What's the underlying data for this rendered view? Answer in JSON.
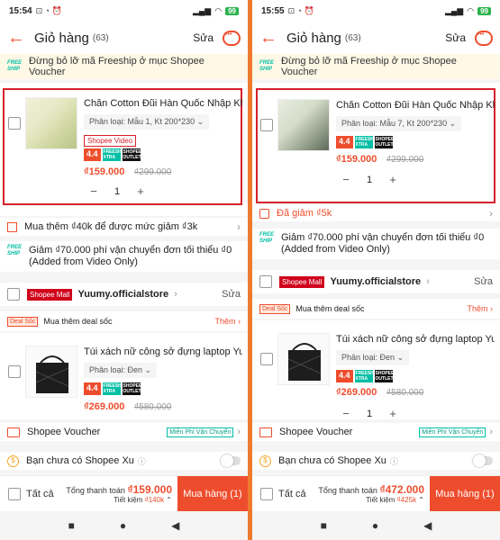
{
  "left": {
    "status": {
      "time": "15:54",
      "battery": "99"
    },
    "header": {
      "back": "←",
      "title": "Giỏ hàng",
      "count": "(63)",
      "edit": "Sửa"
    },
    "freeship_banner": {
      "tag": "FREE SHIP",
      "text": "Đừng bỏ lỡ mã Freeship ở mục Shopee Voucher"
    },
    "item1": {
      "name": "Chăn Cotton Đũi Hàn Quốc Nhập Khẩ...",
      "variant": "Phân loại: Mẫu 1, Kt 200*230",
      "video_badge": "Shopee Video",
      "badge_44": "4.4",
      "badge_free": "FREESHIP XTRA",
      "badge_outlet": "SHOPEE OUTLET",
      "price": "₫159.000",
      "old_price": "₫299.000",
      "qty": "1"
    },
    "promo_row": "Mua thêm ₫40k để được mức giảm ₫3k",
    "ship_discount": {
      "tag": "FREE SHIP",
      "line1": "Giảm ₫70.000 phí vận chuyển đơn tối thiểu ₫0",
      "line2": "(Added from Video Only)"
    },
    "shop": {
      "mall": "Shopee Mall",
      "name": "Yuumy.officialstore",
      "edit": "Sửa"
    },
    "deal": {
      "tag": "Deal Sốc",
      "text": "Mua thêm deal sốc",
      "more": "Thêm"
    },
    "item2": {
      "name": "Túi xách nữ công sở đựng laptop Yuu...",
      "variant": "Phân loại: Đen",
      "badge_44": "4.4",
      "badge_free": "FREESHIP XTRA",
      "badge_outlet": "SHOPEE OUTLET",
      "price": "₫269.000",
      "old_price": "₫580.000"
    },
    "voucher": {
      "label": "Shopee Voucher",
      "badge": "Miễn Phí Vận Chuyển"
    },
    "xu": {
      "label": "Bạn chưa có Shopee Xu"
    },
    "bottom": {
      "all": "Tất cả",
      "total_label": "Tổng thanh toán",
      "total": "₫159.000",
      "save_label": "Tiết kiệm",
      "save": "₫140k",
      "buy": "Mua hàng (1)"
    }
  },
  "right": {
    "status": {
      "time": "15:55",
      "battery": "99"
    },
    "header": {
      "back": "←",
      "title": "Giỏ hàng",
      "count": "(63)",
      "edit": "Sửa"
    },
    "freeship_banner": {
      "tag": "FREE SHIP",
      "text": "Đừng bỏ lỡ mã Freeship ở mục Shopee Voucher"
    },
    "item1": {
      "name": "Chăn Cotton Đũi Hàn Quốc Nhập Khẩ...",
      "variant": "Phân loại: Mẫu 7, Kt 200*230",
      "badge_44": "4.4",
      "badge_free": "FREESHIP XTRA",
      "badge_outlet": "SHOPEE OUTLET",
      "price": "₫159.000",
      "old_price": "₫299.000",
      "qty": "1"
    },
    "discount_row": "Đã giảm ₫5k",
    "ship_discount": {
      "tag": "FREE SHIP",
      "line1": "Giảm ₫70.000 phí vận chuyển đơn tối thiểu ₫0",
      "line2": "(Added from Video Only)"
    },
    "shop": {
      "mall": "Shopee Mall",
      "name": "Yuumy.officialstore",
      "edit": "Sửa"
    },
    "deal": {
      "tag": "Deal Sốc",
      "text": "Mua thêm deal sốc",
      "more": "Thêm"
    },
    "item2": {
      "name": "Túi xách nữ công sở đựng laptop Yuu...",
      "variant": "Phân loại: Đen",
      "badge_44": "4.4",
      "badge_free": "FREESHIP XTRA",
      "badge_outlet": "SHOPEE OUTLET",
      "price": "₫269.000",
      "old_price": "₫580.000",
      "qty": "1"
    },
    "voucher": {
      "label": "Shopee Voucher",
      "badge": "Miễn Phí Vận Chuyển"
    },
    "xu": {
      "label": "Bạn chưa có Shopee Xu"
    },
    "bottom": {
      "all": "Tất cả",
      "total_label": "Tổng thanh toán",
      "total": "₫472.000",
      "save_label": "Tiết kiệm",
      "save": "₫425k",
      "buy": "Mua hàng (1)"
    }
  },
  "colors": {
    "accent": "#ee4d2d",
    "highlight": "#d8202a",
    "divider": "#ee7a2f"
  }
}
